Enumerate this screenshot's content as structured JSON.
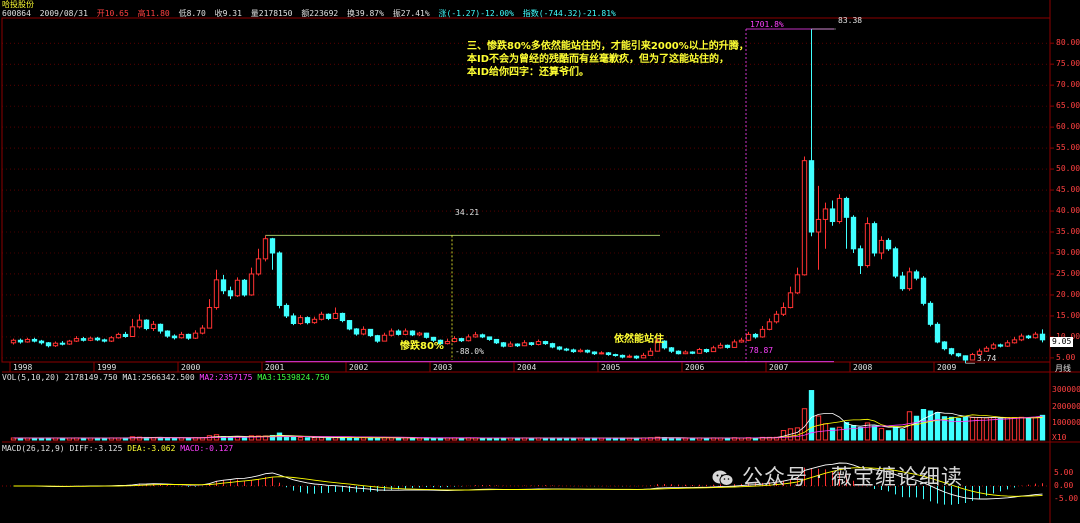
{
  "app": {
    "stock_name": "哈投股份",
    "stock_code": "600864",
    "period_label": "月线"
  },
  "header": {
    "date": "2009/08/31",
    "open": "开10.65",
    "high": "高11.80",
    "low": "低8.70",
    "close": "收9.31",
    "volume": "量2178150",
    "amount": "额223692",
    "turnover": "换39.87%",
    "amplitude": "振27.41%",
    "change": "涨(-1.27)-12.00%",
    "index": "指数(-744.32)-21.81%"
  },
  "volume_header": {
    "label": "VOL(5,10,20)",
    "vol": "2178149.750",
    "ma1": "MA1:2566342.500",
    "ma2": "MA2:2357175",
    "ma3": "MA3:1539824.750"
  },
  "macd_header": {
    "label": "MACD(26,12,9)",
    "diff": "DIFF:-3.125",
    "dea": "DEA:-3.062",
    "macd": "MACD:-0.127"
  },
  "annotations": {
    "text_block": [
      "三、惨跌80%多依然能站住的，才能引来2000%以上的升腾，",
      "本ID不会为曾经的残酷而有丝毫歉疚，但为了这能站住的，",
      "本ID给你四字：还算爷们。"
    ],
    "drop_label": "惨跌80%",
    "stand_label": "依然能站住",
    "high1": "34.21",
    "drop_pct": "-88.0%",
    "high2": "83.38",
    "rise_pct": "1701.8%",
    "low2": "3.74",
    "low_val": "78.87",
    "last_price": "9.05"
  },
  "watermark": "公众号 · 薇宝缠论细读",
  "price_axis": [
    "80.00",
    "75.00",
    "70.00",
    "65.00",
    "60.00",
    "55.00",
    "50.00",
    "45.00",
    "40.00",
    "35.00",
    "30.00",
    "25.00",
    "20.00",
    "15.00",
    "10.00",
    "5.00"
  ],
  "vol_axis": [
    "300000",
    "200000",
    "100000",
    "X10"
  ],
  "macd_axis": [
    "5.00",
    "0.00",
    "-5.00"
  ],
  "year_labels": [
    "1998",
    "1999",
    "2000",
    "2001",
    "2002",
    "2003",
    "2004",
    "2005",
    "2006",
    "2007",
    "2008",
    "2009"
  ],
  "colors": {
    "up": "#ff3232",
    "down": "#40ffff",
    "grid": "#8b0000",
    "ma5": "#ffffff",
    "ma10": "#ffff00",
    "ma20": "#ff40ff"
  },
  "chart_data": {
    "type": "candlestick",
    "x_labels": [
      "1998",
      "1999",
      "2000",
      "2001",
      "2002",
      "2003",
      "2004",
      "2005",
      "2006",
      "2007",
      "2008",
      "2009"
    ],
    "price_ylim": [
      4.5,
      86
    ],
    "key_points": [
      {
        "label": "34.21",
        "value": 34.21,
        "year": "2000"
      },
      {
        "label": "83.38",
        "value": 83.38,
        "year": "2007"
      },
      {
        "label": "3.74",
        "value": 3.74,
        "year": "2008"
      }
    ],
    "candles": [
      [
        8.6,
        9.2,
        9.6,
        8.2
      ],
      [
        9.2,
        8.8,
        9.6,
        8.4
      ],
      [
        8.8,
        9.4,
        9.8,
        8.6
      ],
      [
        9.4,
        9.0,
        9.8,
        8.7
      ],
      [
        9.0,
        8.6,
        9.3,
        8.2
      ],
      [
        8.6,
        7.9,
        8.8,
        7.5
      ],
      [
        7.9,
        8.5,
        8.9,
        7.6
      ],
      [
        8.5,
        8.3,
        9.0,
        8.0
      ],
      [
        8.3,
        9.0,
        9.3,
        8.1
      ],
      [
        9.0,
        9.6,
        10.2,
        8.8
      ],
      [
        9.6,
        9.2,
        10.0,
        8.9
      ],
      [
        9.2,
        9.7,
        10.1,
        9.0
      ],
      [
        9.7,
        9.3,
        10.0,
        9.0
      ],
      [
        9.3,
        9.0,
        9.6,
        8.7
      ],
      [
        9.0,
        9.8,
        10.2,
        8.8
      ],
      [
        9.8,
        10.6,
        11.0,
        9.6
      ],
      [
        10.6,
        10.1,
        11.2,
        9.8
      ],
      [
        10.1,
        12.4,
        14.3,
        10.0
      ],
      [
        12.4,
        14.0,
        15.4,
        12.0
      ],
      [
        14.0,
        12.0,
        14.2,
        11.6
      ],
      [
        12.0,
        13.0,
        13.8,
        11.4
      ],
      [
        13.0,
        11.4,
        13.2,
        10.8
      ],
      [
        11.4,
        10.2,
        11.6,
        9.8
      ],
      [
        10.2,
        9.8,
        10.6,
        9.4
      ],
      [
        9.8,
        10.6,
        11.2,
        9.6
      ],
      [
        10.6,
        9.7,
        10.8,
        9.3
      ],
      [
        9.7,
        10.9,
        11.6,
        9.5
      ],
      [
        10.9,
        12.1,
        12.8,
        10.6
      ],
      [
        12.1,
        17.0,
        19.0,
        12.0
      ],
      [
        17.0,
        23.6,
        26.0,
        16.5
      ],
      [
        23.6,
        21.0,
        24.8,
        20.2
      ],
      [
        21.0,
        19.8,
        22.0,
        19.0
      ],
      [
        19.8,
        23.5,
        24.2,
        19.5
      ],
      [
        23.5,
        20.0,
        23.8,
        19.6
      ],
      [
        20.0,
        25.0,
        26.5,
        19.8
      ],
      [
        25.0,
        28.6,
        31.0,
        24.6
      ],
      [
        28.6,
        33.4,
        34.21,
        28.0
      ],
      [
        33.4,
        30.0,
        33.6,
        26.0
      ],
      [
        30.0,
        17.5,
        30.4,
        16.8
      ],
      [
        17.5,
        15.0,
        18.0,
        14.5
      ],
      [
        15.0,
        13.2,
        15.6,
        12.8
      ],
      [
        13.2,
        14.6,
        15.2,
        12.9
      ],
      [
        14.6,
        13.4,
        14.9,
        13.0
      ],
      [
        13.4,
        14.2,
        14.8,
        13.1
      ],
      [
        14.2,
        15.4,
        16.0,
        13.9
      ],
      [
        15.4,
        14.4,
        15.6,
        14.0
      ],
      [
        14.4,
        15.6,
        17.0,
        14.2
      ],
      [
        15.6,
        13.9,
        15.8,
        13.5
      ],
      [
        13.9,
        11.9,
        14.0,
        11.6
      ],
      [
        11.9,
        10.7,
        12.1,
        10.3
      ],
      [
        10.7,
        11.8,
        12.5,
        10.4
      ],
      [
        11.8,
        10.3,
        11.9,
        10.0
      ],
      [
        10.3,
        9.0,
        10.5,
        8.6
      ],
      [
        9.0,
        10.4,
        11.0,
        8.9
      ],
      [
        10.4,
        11.4,
        12.0,
        10.1
      ],
      [
        11.4,
        10.6,
        11.8,
        10.3
      ],
      [
        10.6,
        11.4,
        12.0,
        10.4
      ],
      [
        11.4,
        10.5,
        11.6,
        10.2
      ],
      [
        10.5,
        10.9,
        11.2,
        10.2
      ],
      [
        10.9,
        9.9,
        11.0,
        9.6
      ],
      [
        9.9,
        9.2,
        10.0,
        8.8
      ],
      [
        9.2,
        8.4,
        9.4,
        8.1
      ],
      [
        8.4,
        8.9,
        9.6,
        8.2
      ],
      [
        8.9,
        9.6,
        10.2,
        8.7
      ],
      [
        9.6,
        9.1,
        9.8,
        8.8
      ],
      [
        9.1,
        10.0,
        10.6,
        8.9
      ],
      [
        10.0,
        10.5,
        11.2,
        9.8
      ],
      [
        10.5,
        10.0,
        10.8,
        9.7
      ],
      [
        10.0,
        9.4,
        10.1,
        9.1
      ],
      [
        9.4,
        8.6,
        9.5,
        8.3
      ],
      [
        8.6,
        7.8,
        8.8,
        7.5
      ],
      [
        7.8,
        8.3,
        8.9,
        7.6
      ],
      [
        8.3,
        7.9,
        8.5,
        7.6
      ],
      [
        7.9,
        8.6,
        9.2,
        7.8
      ],
      [
        8.6,
        8.2,
        8.8,
        7.9
      ],
      [
        8.2,
        8.9,
        9.4,
        8.0
      ],
      [
        8.9,
        8.4,
        9.1,
        8.1
      ],
      [
        8.4,
        7.6,
        8.6,
        7.3
      ],
      [
        7.6,
        7.1,
        7.8,
        6.8
      ],
      [
        7.1,
        6.9,
        7.4,
        6.6
      ],
      [
        6.9,
        6.5,
        7.2,
        6.2
      ],
      [
        6.5,
        6.8,
        7.2,
        6.3
      ],
      [
        6.8,
        6.4,
        7.0,
        6.1
      ],
      [
        6.4,
        6.0,
        6.6,
        5.7
      ],
      [
        6.0,
        6.2,
        6.6,
        5.8
      ],
      [
        6.2,
        5.8,
        6.4,
        5.5
      ],
      [
        5.8,
        5.6,
        6.0,
        5.3
      ],
      [
        5.6,
        5.2,
        5.8,
        4.9
      ],
      [
        5.2,
        5.4,
        5.8,
        5.0
      ],
      [
        5.4,
        5.0,
        5.6,
        4.7
      ],
      [
        5.0,
        5.6,
        6.2,
        4.9
      ],
      [
        5.6,
        6.6,
        7.4,
        5.5
      ],
      [
        6.6,
        9.0,
        9.8,
        6.5
      ],
      [
        9.0,
        7.4,
        9.2,
        7.0
      ],
      [
        7.4,
        6.6,
        7.6,
        6.2
      ],
      [
        6.6,
        6.0,
        6.8,
        5.8
      ],
      [
        6.0,
        6.4,
        6.8,
        5.9
      ],
      [
        6.4,
        6.1,
        6.6,
        5.9
      ],
      [
        6.1,
        7.0,
        7.4,
        6.0
      ],
      [
        7.0,
        6.5,
        7.2,
        6.2
      ],
      [
        6.5,
        7.4,
        7.9,
        6.4
      ],
      [
        7.4,
        8.0,
        8.6,
        7.2
      ],
      [
        8.0,
        7.5,
        8.2,
        7.2
      ],
      [
        7.5,
        8.8,
        9.4,
        7.4
      ],
      [
        8.8,
        9.2,
        9.8,
        8.6
      ],
      [
        9.2,
        10.6,
        11.2,
        9.0
      ],
      [
        10.6,
        10.0,
        10.9,
        9.6
      ],
      [
        10.0,
        11.8,
        12.6,
        9.8
      ],
      [
        11.8,
        13.6,
        14.4,
        11.6
      ],
      [
        13.6,
        15.4,
        16.2,
        13.2
      ],
      [
        15.4,
        17.0,
        18.2,
        15.0
      ],
      [
        17.0,
        20.5,
        22.0,
        16.8
      ],
      [
        20.5,
        24.8,
        26.5,
        20.2
      ],
      [
        24.8,
        52.0,
        53.0,
        24.6
      ],
      [
        52.0,
        35.0,
        83.38,
        34.0
      ],
      [
        35.0,
        38.0,
        46.0,
        26.0
      ],
      [
        38.0,
        40.5,
        42.0,
        31.0
      ],
      [
        40.5,
        37.5,
        42.5,
        36.5
      ],
      [
        37.5,
        43.0,
        44.0,
        37.0
      ],
      [
        43.0,
        38.5,
        43.4,
        31.0
      ],
      [
        38.5,
        31.0,
        39.0,
        30.0
      ],
      [
        31.0,
        27.0,
        31.8,
        25.0
      ],
      [
        27.0,
        37.0,
        38.5,
        26.5
      ],
      [
        37.0,
        30.0,
        37.5,
        29.2
      ],
      [
        30.0,
        33.0,
        34.0,
        28.5
      ],
      [
        33.0,
        31.0,
        33.5,
        30.5
      ],
      [
        31.0,
        24.5,
        31.5,
        24.0
      ],
      [
        24.5,
        21.5,
        25.5,
        21.0
      ],
      [
        21.5,
        25.5,
        26.5,
        21.0
      ],
      [
        25.5,
        24.0,
        26.0,
        23.5
      ],
      [
        24.0,
        18.0,
        24.5,
        17.5
      ],
      [
        18.0,
        13.0,
        18.5,
        12.5
      ],
      [
        13.0,
        8.8,
        13.5,
        8.5
      ],
      [
        8.8,
        7.2,
        9.0,
        6.8
      ],
      [
        7.2,
        6.0,
        7.4,
        5.6
      ],
      [
        6.0,
        5.5,
        6.2,
        5.2
      ],
      [
        5.5,
        4.5,
        5.6,
        3.74
      ],
      [
        4.5,
        5.8,
        6.2,
        4.4
      ],
      [
        5.8,
        6.6,
        7.2,
        5.6
      ],
      [
        6.6,
        7.3,
        7.8,
        6.4
      ],
      [
        7.3,
        8.1,
        8.6,
        7.0
      ],
      [
        8.1,
        7.8,
        8.4,
        7.5
      ],
      [
        7.8,
        8.6,
        9.2,
        7.6
      ],
      [
        8.6,
        9.3,
        10.0,
        8.4
      ],
      [
        9.3,
        10.2,
        10.8,
        9.0
      ],
      [
        10.2,
        9.8,
        10.5,
        9.5
      ],
      [
        9.8,
        10.65,
        11.2,
        9.6
      ],
      [
        10.65,
        9.31,
        11.8,
        8.7
      ]
    ]
  }
}
